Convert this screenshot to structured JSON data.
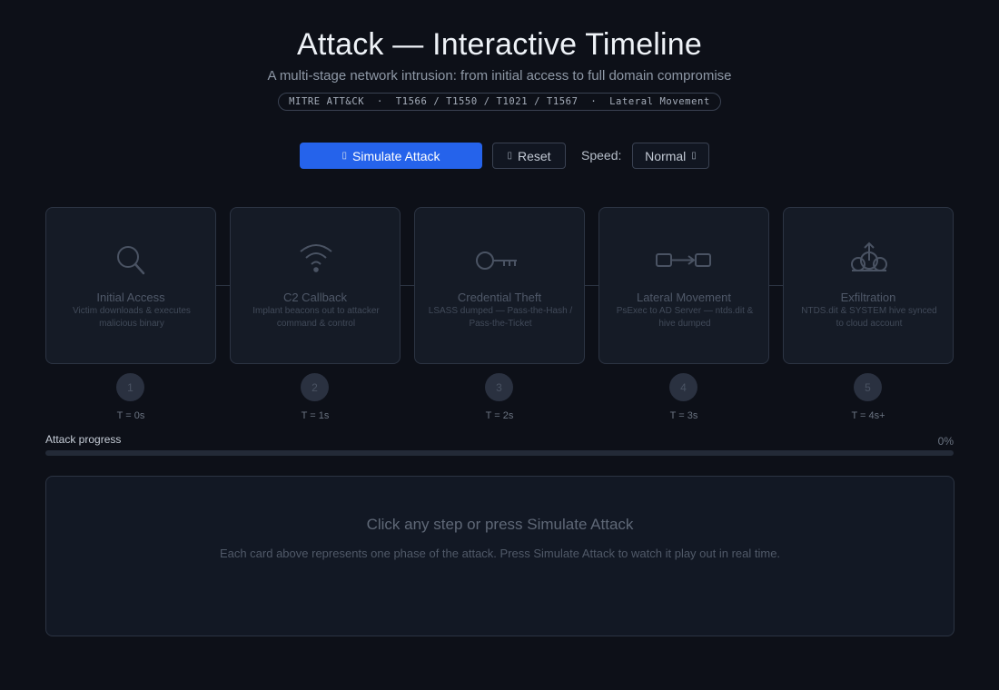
{
  "header": {
    "title": "Attack — Interactive Timeline",
    "subtitle": "A multi-stage network intrusion: from initial access to full domain compromise",
    "tag": "MITRE ATT&CK  ·  T1566 / T1550 / T1021 / T1567  ·  Lateral Movement"
  },
  "controls": {
    "simulate_label": "Simulate Attack",
    "simulate_icon": "play-icon",
    "reset_label": "Reset",
    "reset_icon": "reset-icon",
    "speed_label": "Speed:",
    "speed_value": "Normal",
    "speed_icon": "chevron-down-icon"
  },
  "steps": [
    {
      "number": "1",
      "title": "Initial Access",
      "desc": "Victim downloads & executes malicious binary",
      "time": "T = 0s",
      "icon": "search-icon"
    },
    {
      "number": "2",
      "title": "C2 Callback",
      "desc": "Implant beacons out to attacker command & control",
      "time": "T = 1s",
      "icon": "wifi-icon"
    },
    {
      "number": "3",
      "title": "Credential Theft",
      "desc": "LSASS dumped — Pass-the-Hash / Pass-the-Ticket",
      "time": "T = 2s",
      "icon": "key-icon"
    },
    {
      "number": "4",
      "title": "Lateral Movement",
      "desc": "PsExec to AD Server — ntds.dit & hive dumped",
      "time": "T = 3s",
      "icon": "lateral-arrow-icon"
    },
    {
      "number": "5",
      "title": "Exfiltration",
      "desc": "NTDS.dit & SYSTEM hive synced to cloud account",
      "time": "T = 4s+",
      "icon": "cloud-upload-icon"
    }
  ],
  "progress": {
    "label": "Attack progress",
    "percent_text": "0%",
    "value": 0
  },
  "info": {
    "title": "Click any step or press Simulate Attack",
    "text": "Each card above represents one phase of the attack. Press Simulate Attack to watch it play out in real time."
  },
  "colors": {
    "background": "#0d1018",
    "accent": "#2563eb",
    "card": "#151b26",
    "border": "#2c3443"
  }
}
